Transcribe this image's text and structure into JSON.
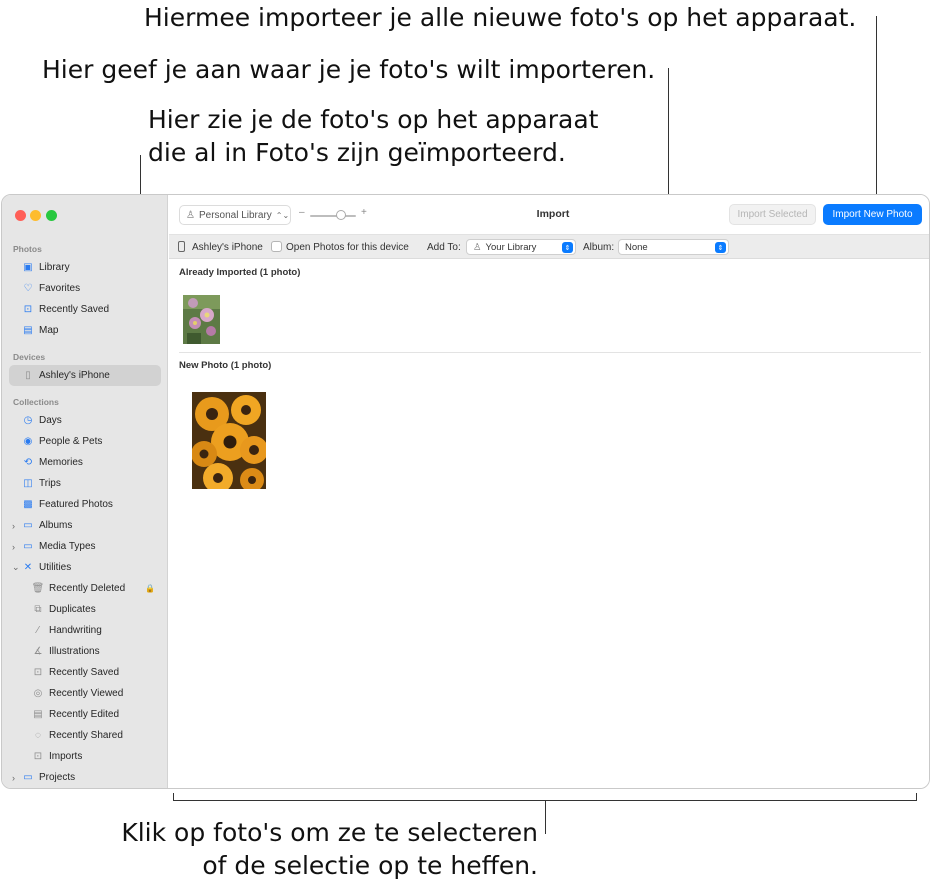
{
  "callouts": {
    "import_new": "Hiermee importeer je alle nieuwe foto's op het apparaat.",
    "import_dest": "Hier geef je aan waar je je foto's wilt importeren.",
    "already_line1": "Hier zie je de foto's op het apparaat",
    "already_line2": "die al in Foto's zijn geïmporteerd.",
    "select_line1": "Klik op foto's om ze te selecteren",
    "select_line2": "of de selectie op te heffen."
  },
  "sidebar": {
    "photos_header": "Photos",
    "photos": [
      {
        "label": "Library",
        "icon": "library-icon"
      },
      {
        "label": "Favorites",
        "icon": "heart-icon"
      },
      {
        "label": "Recently Saved",
        "icon": "tray-icon"
      },
      {
        "label": "Map",
        "icon": "map-icon"
      }
    ],
    "devices_header": "Devices",
    "device": "Ashley's iPhone",
    "collections_header": "Collections",
    "collections": [
      {
        "label": "Days",
        "icon": "clock-icon"
      },
      {
        "label": "People & Pets",
        "icon": "person-icon"
      },
      {
        "label": "Memories",
        "icon": "memories-icon"
      },
      {
        "label": "Trips",
        "icon": "suitcase-icon"
      },
      {
        "label": "Featured Photos",
        "icon": "photo-icon"
      },
      {
        "label": "Albums",
        "icon": "folder-icon"
      },
      {
        "label": "Media Types",
        "icon": "folder-icon"
      },
      {
        "label": "Utilities",
        "icon": "tools-icon"
      }
    ],
    "utilities": [
      {
        "label": "Recently Deleted",
        "icon": "trash-icon"
      },
      {
        "label": "Duplicates",
        "icon": "duplicates-icon"
      },
      {
        "label": "Handwriting",
        "icon": "pen-icon"
      },
      {
        "label": "Illustrations",
        "icon": "illustrations-icon"
      },
      {
        "label": "Recently Saved",
        "icon": "tray-icon"
      },
      {
        "label": "Recently Viewed",
        "icon": "eye-icon"
      },
      {
        "label": "Recently Edited",
        "icon": "edit-icon"
      },
      {
        "label": "Recently Shared",
        "icon": "share-icon"
      },
      {
        "label": "Imports",
        "icon": "import-icon"
      }
    ],
    "projects": "Projects"
  },
  "toolbar": {
    "library_picker": "Personal Library",
    "zoom_minus": "–",
    "zoom_plus": "+",
    "title": "Import",
    "import_selected": "Import Selected",
    "import_new": "Import New Photo"
  },
  "devicebar": {
    "device": "Ashley's iPhone",
    "open_photos": "Open Photos for this device",
    "add_to_label": "Add To:",
    "add_to_value": "Your Library",
    "album_label": "Album:",
    "album_value": "None"
  },
  "content": {
    "already_imported": "Already Imported (1 photo)",
    "new_photo": "New Photo (1 photo)"
  },
  "colors": {
    "accent": "#0a7bff",
    "sidebar_bg": "#e6e6e6"
  }
}
